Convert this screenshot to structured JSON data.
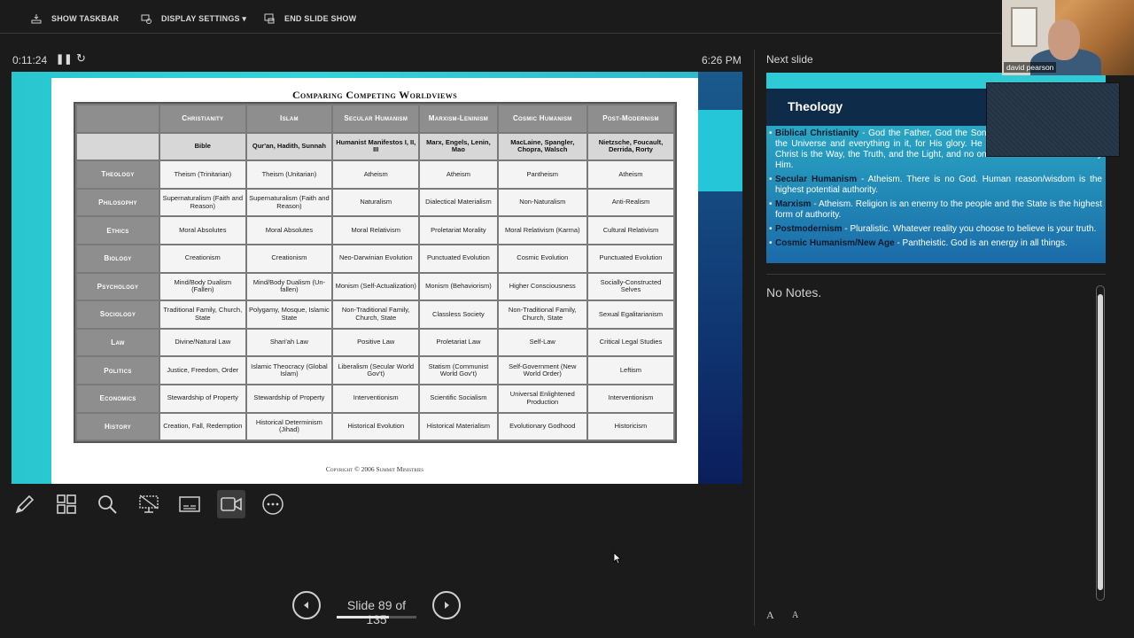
{
  "toolbar": {
    "show_taskbar": "SHOW TASKBAR",
    "display_settings": "DISPLAY SETTINGS ▾",
    "end_slide_show": "END SLIDE SHOW"
  },
  "status": {
    "timer": "0:11:24",
    "clock": "6:26 PM"
  },
  "current_slide": {
    "title": "Comparing Competing Worldviews",
    "columns": [
      "Christianity",
      "Islam",
      "Secular Humanism",
      "Marxism-Leninism",
      "Cosmic Humanism",
      "Post-Modernism"
    ],
    "sources": [
      "Bible",
      "Qur'an, Hadith, Sunnah",
      "Humanist Manifestos I, II, III",
      "Marx, Engels, Lenin, Mao",
      "MacLaine, Spangler, Chopra, Walsch",
      "Nietzsche, Foucault, Derrida, Rorty"
    ],
    "rows": [
      {
        "label": "Theology",
        "cells": [
          "Theism (Trinitarian)",
          "Theism (Unitarian)",
          "Atheism",
          "Atheism",
          "Pantheism",
          "Atheism"
        ]
      },
      {
        "label": "Philosophy",
        "cells": [
          "Supernaturalism (Faith and Reason)",
          "Supernaturalism (Faith and Reason)",
          "Naturalism",
          "Dialectical Materialism",
          "Non-Naturalism",
          "Anti-Realism"
        ]
      },
      {
        "label": "Ethics",
        "cells": [
          "Moral Absolutes",
          "Moral Absolutes",
          "Moral Relativism",
          "Proletariat Morality",
          "Moral Relativism (Karma)",
          "Cultural Relativism"
        ]
      },
      {
        "label": "Biology",
        "cells": [
          "Creationism",
          "Creationism",
          "Neo-Darwinian Evolution",
          "Punctuated Evolution",
          "Cosmic Evolution",
          "Punctuated Evolution"
        ]
      },
      {
        "label": "Psychology",
        "cells": [
          "Mind/Body Dualism (Fallen)",
          "Mind/Body Dualism (Un-fallen)",
          "Monism (Self-Actualization)",
          "Monism (Behaviorism)",
          "Higher Consciousness",
          "Socially-Constructed Selves"
        ]
      },
      {
        "label": "Sociology",
        "cells": [
          "Traditional Family, Church, State",
          "Polygamy, Mosque, Islamic State",
          "Non-Traditional Family, Church, State",
          "Classless Society",
          "Non-Traditional Family, Church, State",
          "Sexual Egalitarianism"
        ]
      },
      {
        "label": "Law",
        "cells": [
          "Divine/Natural Law",
          "Shari'ah Law",
          "Positive Law",
          "Proletariat Law",
          "Self-Law",
          "Critical Legal Studies"
        ]
      },
      {
        "label": "Politics",
        "cells": [
          "Justice, Freedom, Order",
          "Islamic Theocracy (Global Islam)",
          "Liberalism (Secular World Gov't)",
          "Statism (Communist World Gov't)",
          "Self-Government (New World Order)",
          "Leftism"
        ]
      },
      {
        "label": "Economics",
        "cells": [
          "Stewardship of Property",
          "Stewardship of Property",
          "Interventionism",
          "Scientific Socialism",
          "Universal Enlightened Production",
          "Interventionism"
        ]
      },
      {
        "label": "History",
        "cells": [
          "Creation, Fall, Redemption",
          "Historical Determinism (Jihad)",
          "Historical Evolution",
          "Historical Materialism",
          "Evolutionary Godhood",
          "Historicism"
        ]
      }
    ],
    "copyright": "Copyright © 2006 Summit Ministries"
  },
  "navigation": {
    "slide_label": "Slide 89 of 135",
    "progress": 0.66
  },
  "next_slide": {
    "label": "Next slide",
    "title": "Theology",
    "items": [
      {
        "term": "Biblical Christianity",
        "text": " - God the Father, God the Son, God the Holy Spirit created the Universe and everything in it, for His glory. He sustains all existence. Jesus Christ is the Way, the Truth, and the Light, and no one comes to the Father but by Him."
      },
      {
        "term": "Secular Humanism",
        "text": " - Atheism. There is no God. Human reason/wisdom is the highest potential authority."
      },
      {
        "term": "Marxism",
        "text": " - Atheism. Religion is an enemy to the people and the State is the highest form of authority."
      },
      {
        "term": "Postmodernism",
        "text": " - Pluralistic. Whatever reality you choose to believe is your truth."
      },
      {
        "term": "Cosmic Humanism/New Age",
        "text": " - Pantheistic. God is an energy in all things."
      }
    ]
  },
  "notes": {
    "text": "No Notes."
  },
  "webcam": {
    "name": "david pearson"
  },
  "font_controls": {
    "increase": "A",
    "decrease": "A"
  },
  "tools": [
    "pen-icon",
    "slides-grid-icon",
    "zoom-icon",
    "pointer-screen-icon",
    "subtitles-icon",
    "camera-icon",
    "more-options-icon"
  ]
}
